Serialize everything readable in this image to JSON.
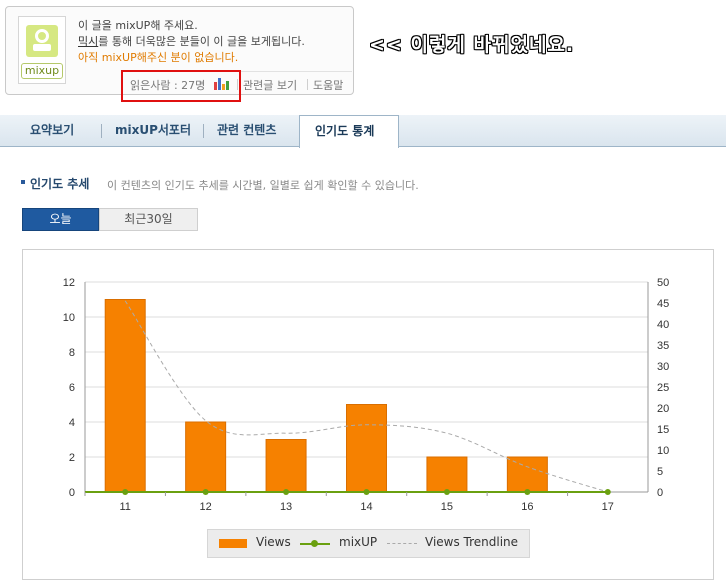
{
  "widget": {
    "logo_label": "mixup",
    "line1": "이 글을 mixUP해 주세요.",
    "line2_link": "믹시",
    "line2_rest": "를 통해 더욱많은 분들이 이 글을 보게됩니다.",
    "line3": "아직 mixUP해주신 분이 없습니다.",
    "readers": "읽은사람 : 27명",
    "related": "관련글 보기",
    "help": "도움말"
  },
  "annotation": "<< 이렇게 바뀌었네요.",
  "tabs": [
    {
      "label": "요약보기"
    },
    {
      "label": "mixUP서포터"
    },
    {
      "label": "관련 컨텐츠"
    },
    {
      "label": "인기도 통계",
      "active": true
    }
  ],
  "section": {
    "title": "인기도 추세",
    "description": "이 컨텐츠의 인기도 추세를 시간별, 일별로 쉽게 확인할 수 있습니다."
  },
  "period": {
    "today": "오늘",
    "last30": "최근30일",
    "selected": "오늘"
  },
  "colors": {
    "views": "#f68100",
    "mixup": "#6aa010",
    "trend": "#aaaaaa",
    "tab_text": "#2a4f72",
    "toggle_on": "#1f5aa0"
  },
  "chart_data": {
    "type": "bar",
    "categories": [
      "11",
      "12",
      "13",
      "14",
      "15",
      "16",
      "17"
    ],
    "series": [
      {
        "name": "Views",
        "type": "bar",
        "axis": "left",
        "values": [
          11,
          4,
          3,
          5,
          2,
          2,
          0
        ]
      },
      {
        "name": "mixUP",
        "type": "line",
        "axis": "left",
        "values": [
          0,
          0,
          0,
          0,
          0,
          0,
          0
        ]
      },
      {
        "name": "Views Trendline",
        "type": "line",
        "style": "dashed",
        "axis": "right",
        "values": [
          45.5,
          17,
          14,
          16,
          14,
          6,
          0
        ]
      }
    ],
    "ylim_left": [
      0,
      12
    ],
    "yticks_left": [
      "0",
      "2",
      "4",
      "6",
      "8",
      "10",
      "12"
    ],
    "ylim_right": [
      0,
      50
    ],
    "yticks_right": [
      "0",
      "5",
      "10",
      "15",
      "20",
      "25",
      "30",
      "35",
      "40",
      "45",
      "50"
    ],
    "grid": true,
    "legend": "bottom-center"
  }
}
